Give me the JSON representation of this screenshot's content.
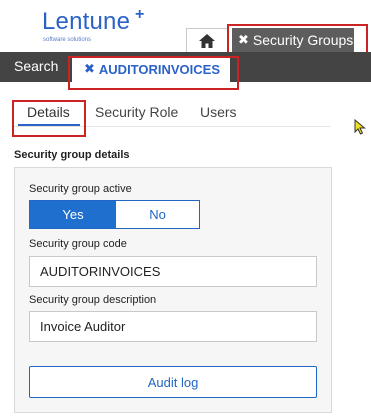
{
  "brand": {
    "name": "Lentune",
    "plus": "+",
    "tagline": "software solutions",
    "color": "#2b62c8"
  },
  "top_tabs": {
    "home_icon": "home-icon",
    "security_groups": {
      "close_glyph": "✖",
      "label": "Security Groups"
    }
  },
  "nav": {
    "search_label": "Search"
  },
  "doc_tab": {
    "close_glyph": "✖",
    "label": "AUDITORINVOICES"
  },
  "sub_tabs": [
    {
      "label": "Details",
      "active": true
    },
    {
      "label": "Security Role",
      "active": false
    },
    {
      "label": "Users",
      "active": false
    }
  ],
  "section": {
    "title": "Security group details",
    "active": {
      "label": "Security group active",
      "yes": "Yes",
      "no": "No",
      "value": "Yes"
    },
    "code": {
      "label": "Security group code",
      "value": "AUDITORINVOICES"
    },
    "description": {
      "label": "Security group description",
      "value": "Invoice Auditor"
    },
    "audit_button": "Audit log"
  },
  "colors": {
    "accent": "#1f6fcf",
    "highlight": "#cc2222",
    "dark_bar": "#444444",
    "active_tab": "#5d5d5d"
  }
}
